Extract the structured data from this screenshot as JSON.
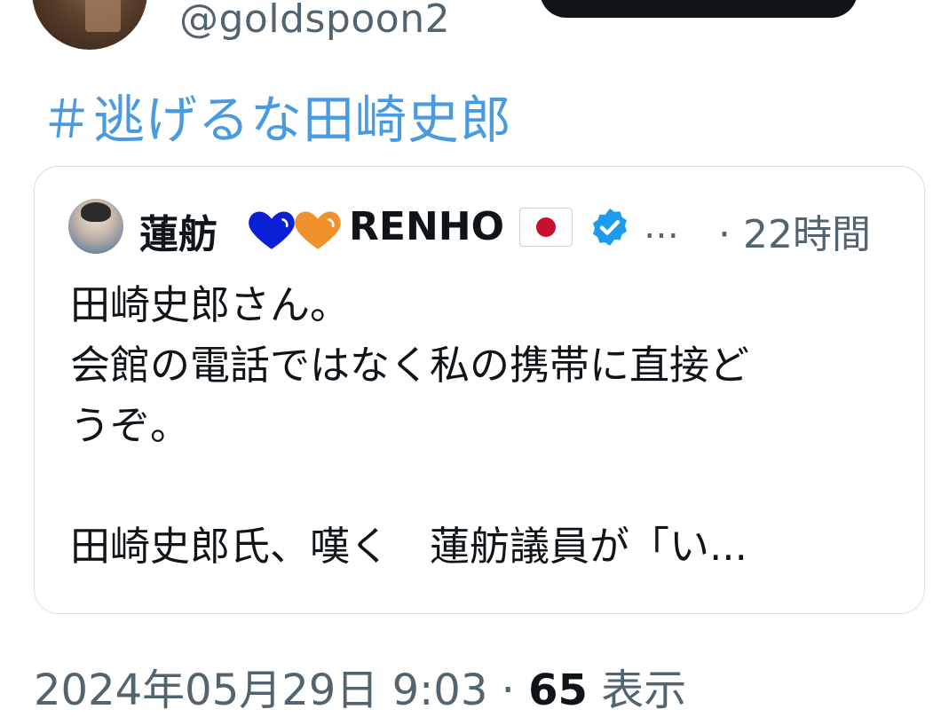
{
  "author": {
    "handle": "@goldspoon2"
  },
  "hashtag": "＃逃げるな田崎史郎",
  "quoted_tweet": {
    "author_name": "蓮舫",
    "author_name_suffix": "RENHO",
    "hearts": [
      "blue-heart",
      "orange-heart"
    ],
    "flag": "japan-flag",
    "verified": "verified-badge-icon",
    "ellipsis": "…",
    "time": "· 22時間",
    "body_lines": [
      "田崎史郎さん。",
      "会館の電話ではなく私の携帯に直接ど",
      "うぞ。",
      "",
      "田崎史郎氏、嘆く　蓮舫議員が「い..."
    ]
  },
  "meta": {
    "timestamp": "2024年05月29日 9:03 · ",
    "views_count": "65",
    "views_label": " 表示"
  },
  "colors": {
    "hashtag": "#4a9ae0",
    "secondary_text": "#536471",
    "primary_text": "#0f1419",
    "blue_heart": "#0a1fd6",
    "orange_heart": "#f0922c",
    "verified": "#1d9bf0"
  }
}
